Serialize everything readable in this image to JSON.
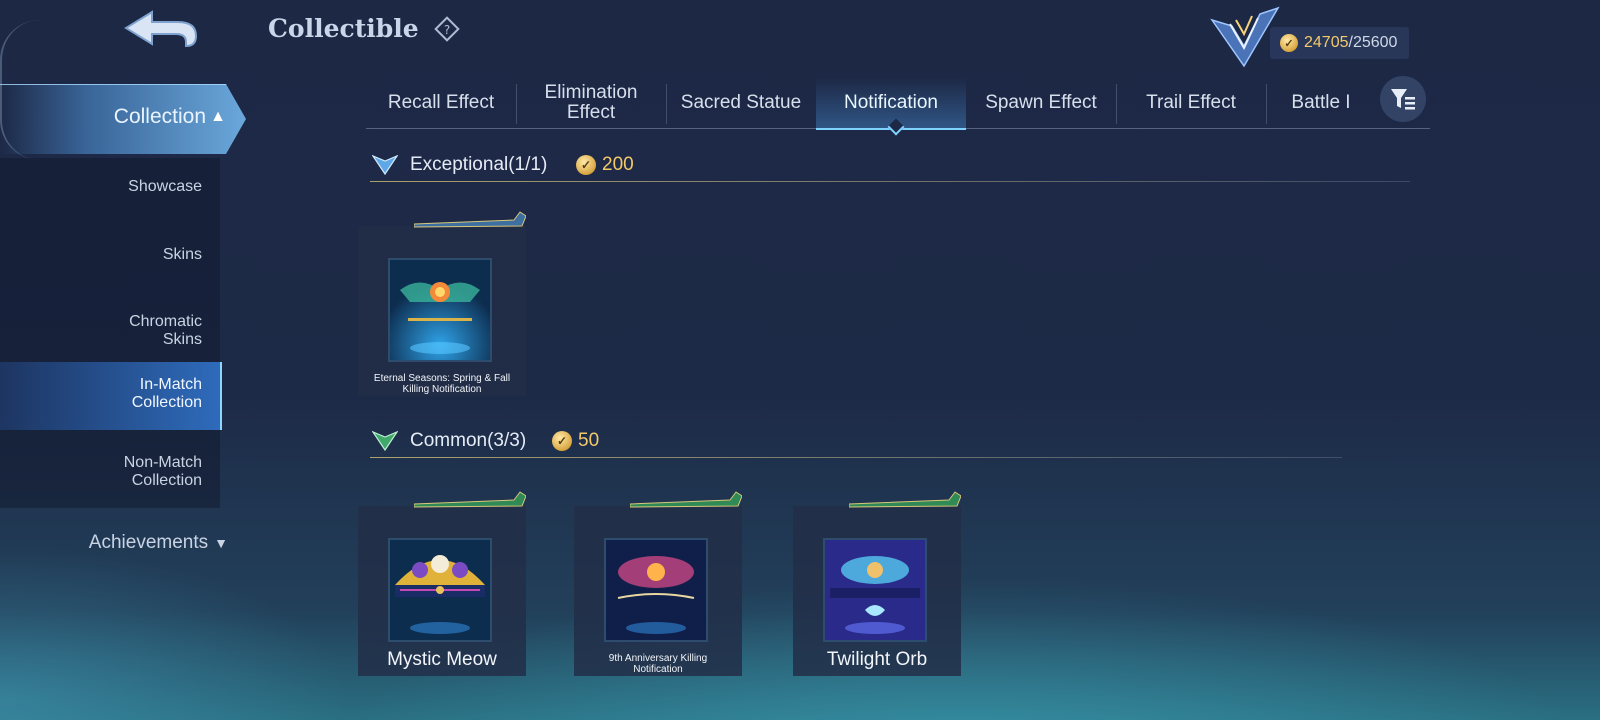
{
  "header": {
    "title": "Collectible",
    "points_current": "24705",
    "points_separator": "/",
    "points_max": "25600"
  },
  "sidebar": {
    "section_title": "Collection",
    "items": [
      {
        "line1": "Showcase",
        "line2": ""
      },
      {
        "line1": "Skins",
        "line2": ""
      },
      {
        "line1": "Chromatic",
        "line2": "Skins"
      },
      {
        "line1": "In-Match",
        "line2": "Collection"
      },
      {
        "line1": "Non-Match",
        "line2": "Collection"
      }
    ],
    "achievements": "Achievements"
  },
  "tabs": [
    {
      "line1": "Recall Effect",
      "line2": ""
    },
    {
      "line1": "Elimination",
      "line2": "Effect"
    },
    {
      "line1": "Sacred Statue",
      "line2": ""
    },
    {
      "line1": "Notification",
      "line2": ""
    },
    {
      "line1": "Spawn Effect",
      "line2": ""
    },
    {
      "line1": "Trail Effect",
      "line2": ""
    },
    {
      "line1": "Battle I",
      "line2": ""
    }
  ],
  "active_tab_index": 3,
  "sections": [
    {
      "name": "Exceptional(1/1)",
      "cost": "200",
      "items": [
        {
          "line1": "Eternal Seasons: Spring & Fall",
          "line2": "Killing Notification"
        }
      ]
    },
    {
      "name": "Common(3/3)",
      "cost": "50",
      "items": [
        {
          "line1": "Mystic Meow",
          "line2": ""
        },
        {
          "line1": "9th Anniversary Killing",
          "line2": "Notification"
        },
        {
          "line1": "Twilight Orb",
          "line2": ""
        }
      ]
    }
  ],
  "icons": {
    "back": "back-arrow-icon",
    "help": "help-diamond-icon",
    "rank": "rank-emblem-icon",
    "coin": "coin-icon",
    "filter": "filter-icon",
    "chevron_up": "chevron-up-icon",
    "chevron_down": "chevron-down-icon",
    "exceptional_gem": "exceptional-gem-icon",
    "common_gem": "common-gem-icon"
  },
  "colors": {
    "gold": "#f3c96a",
    "accent": "#7fd2ff",
    "common_green": "#3fa86a"
  }
}
